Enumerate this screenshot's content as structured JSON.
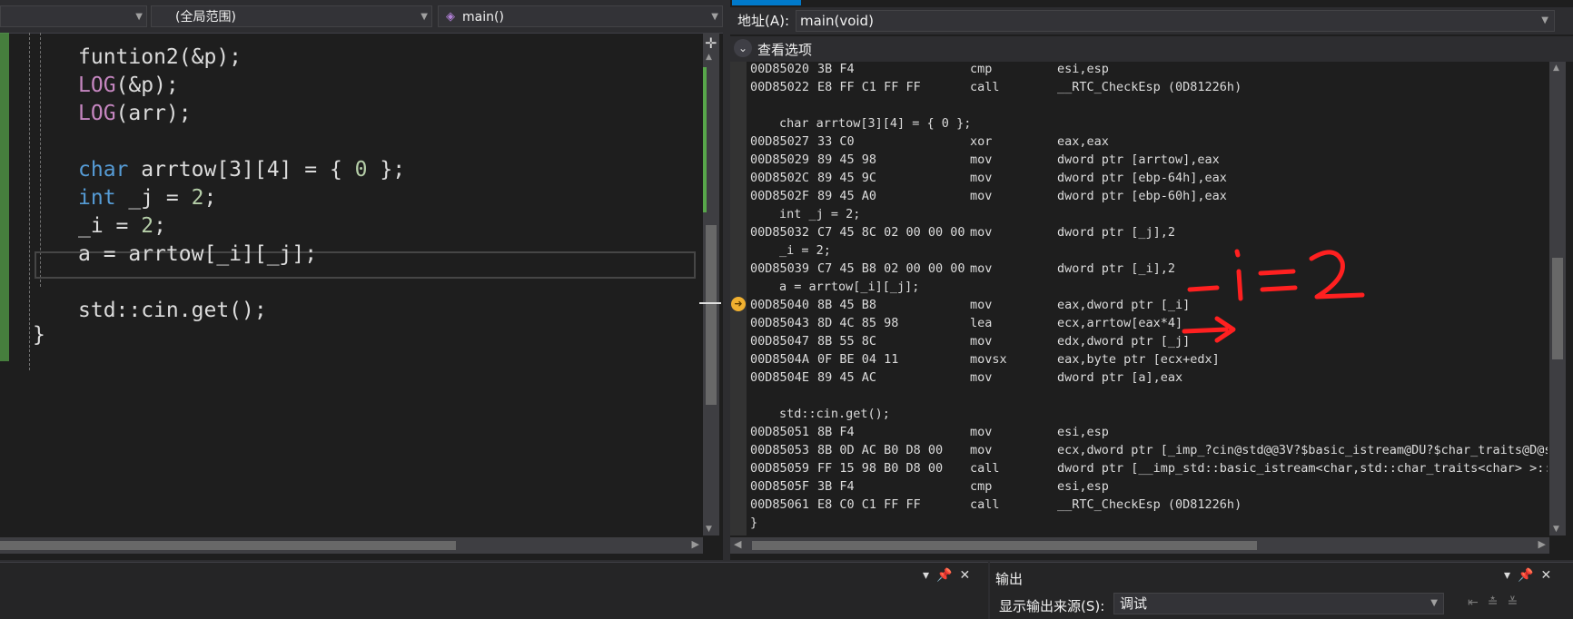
{
  "editor": {
    "scope_combo": "(全局范围)",
    "function_combo": "main()",
    "lines": [
      {
        "parts": [
          {
            "t": "funtion2(&p);",
            "c": ""
          }
        ]
      },
      {
        "parts": [
          {
            "t": "LOG",
            "c": "fn"
          },
          {
            "t": "(&p);",
            "c": ""
          }
        ]
      },
      {
        "parts": [
          {
            "t": "LOG",
            "c": "fn"
          },
          {
            "t": "(arr);",
            "c": ""
          }
        ]
      },
      {
        "parts": []
      },
      {
        "parts": [
          {
            "t": "char",
            "c": "kw"
          },
          {
            "t": " arrtow[3][4] = { ",
            "c": ""
          },
          {
            "t": "0",
            "c": "num"
          },
          {
            "t": " };",
            "c": ""
          }
        ]
      },
      {
        "parts": [
          {
            "t": "int",
            "c": "kw"
          },
          {
            "t": " _j = ",
            "c": ""
          },
          {
            "t": "2",
            "c": "num"
          },
          {
            "t": ";",
            "c": ""
          }
        ]
      },
      {
        "parts": [
          {
            "t": "_i = ",
            "c": ""
          },
          {
            "t": "2",
            "c": "num"
          },
          {
            "t": ";",
            "c": ""
          }
        ]
      },
      {
        "parts": [
          {
            "t": "a = arrtow[_i][_j];",
            "c": ""
          }
        ]
      },
      {
        "parts": []
      },
      {
        "parts": [
          {
            "t": "std::cin.get();",
            "c": ""
          }
        ]
      },
      {
        "parts": [
          {
            "t": "}",
            "c": ""
          }
        ]
      }
    ]
  },
  "disassembly": {
    "address_label": "地址(A):",
    "address_value": "main(void)",
    "view_options_label": "查看选项",
    "lines": [
      {
        "addr": "00D85020",
        "bytes": "3B F4",
        "op": "cmp",
        "arg": "esi,esp"
      },
      {
        "addr": "00D85022",
        "bytes": "E8 FF C1 FF FF",
        "op": "call",
        "arg": "__RTC_CheckEsp (0D81226h)"
      },
      {
        "src": ""
      },
      {
        "src": "char arrtow[3][4] = { 0 };"
      },
      {
        "addr": "00D85027",
        "bytes": "33 C0",
        "op": "xor",
        "arg": "eax,eax"
      },
      {
        "addr": "00D85029",
        "bytes": "89 45 98",
        "op": "mov",
        "arg": "dword ptr [arrtow],eax"
      },
      {
        "addr": "00D8502C",
        "bytes": "89 45 9C",
        "op": "mov",
        "arg": "dword ptr [ebp-64h],eax"
      },
      {
        "addr": "00D8502F",
        "bytes": "89 45 A0",
        "op": "mov",
        "arg": "dword ptr [ebp-60h],eax"
      },
      {
        "src": "int _j = 2;"
      },
      {
        "addr": "00D85032",
        "bytes": "C7 45 8C 02 00 00 00",
        "op": "mov",
        "arg": "dword ptr [_j],2"
      },
      {
        "src": "_i = 2;"
      },
      {
        "addr": "00D85039",
        "bytes": "C7 45 B8 02 00 00 00",
        "op": "mov",
        "arg": "dword ptr [_i],2"
      },
      {
        "src": "a = arrtow[_i][_j];"
      },
      {
        "addr": "00D85040",
        "bytes": "8B 45 B8",
        "op": "mov",
        "arg": "eax,dword ptr [_i]"
      },
      {
        "addr": "00D85043",
        "bytes": "8D 4C 85 98",
        "op": "lea",
        "arg": "ecx,arrtow[eax*4]"
      },
      {
        "addr": "00D85047",
        "bytes": "8B 55 8C",
        "op": "mov",
        "arg": "edx,dword ptr [_j]"
      },
      {
        "addr": "00D8504A",
        "bytes": "0F BE 04 11",
        "op": "movsx",
        "arg": "eax,byte ptr [ecx+edx]"
      },
      {
        "addr": "00D8504E",
        "bytes": "89 45 AC",
        "op": "mov",
        "arg": "dword ptr [a],eax"
      },
      {
        "src": ""
      },
      {
        "src": "std::cin.get();"
      },
      {
        "addr": "00D85051",
        "bytes": "8B F4",
        "op": "mov",
        "arg": "esi,esp"
      },
      {
        "addr": "00D85053",
        "bytes": "8B 0D AC B0 D8 00",
        "op": "mov",
        "arg": "ecx,dword ptr [_imp_?cin@std@@3V?$basic_istream@DU?$char_traits@D@s"
      },
      {
        "addr": "00D85059",
        "bytes": "FF 15 98 B0 D8 00",
        "op": "call",
        "arg": "dword ptr [__imp_std::basic_istream<char,std::char_traits<char> >::"
      },
      {
        "addr": "00D8505F",
        "bytes": "3B F4",
        "op": "cmp",
        "arg": "esi,esp"
      },
      {
        "addr": "00D85061",
        "bytes": "E8 C0 C1 FF FF",
        "op": "call",
        "arg": "__RTC_CheckEsp (0D81226h)"
      },
      {
        "src_raw": "}"
      }
    ],
    "current_line_index": 13,
    "annotation_text": "-i=2",
    "annotation_color": "#ff2020"
  },
  "output_panel": {
    "title": "输出",
    "source_label": "显示输出来源(S):",
    "source_value": "调试"
  },
  "colors": {
    "keyword": "#569cd6",
    "macro": "#c586c0",
    "number": "#b5cea8",
    "accent": "#007acc"
  }
}
